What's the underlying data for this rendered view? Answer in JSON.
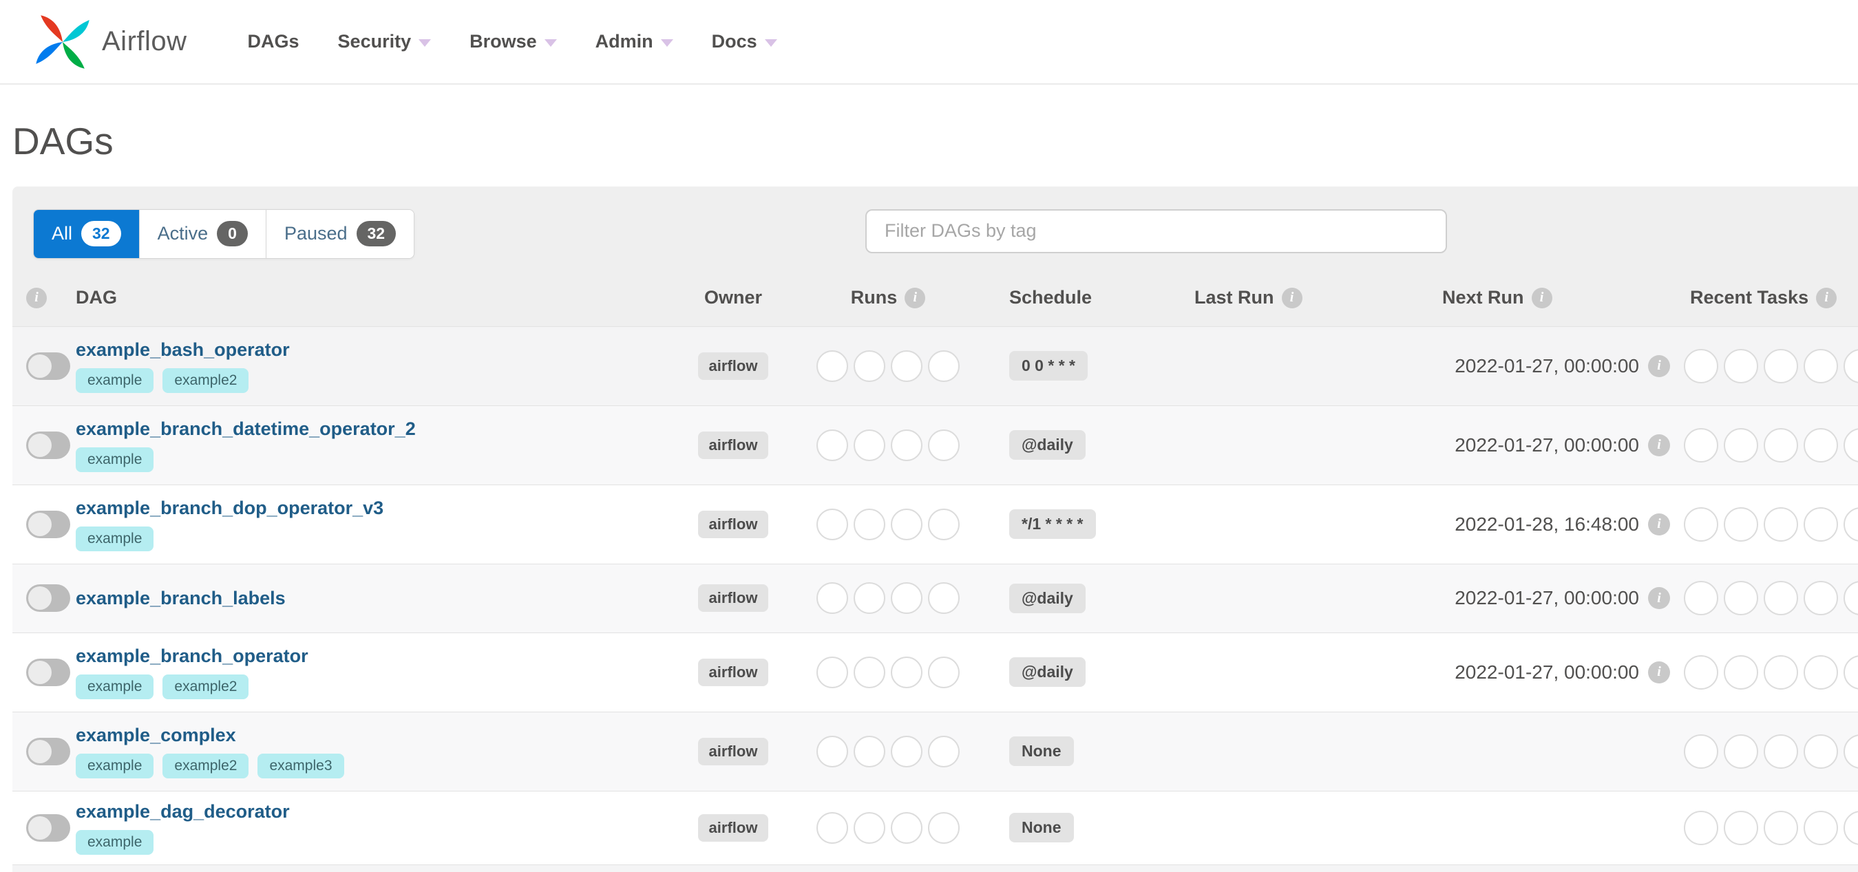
{
  "nav": {
    "brand": "Airflow",
    "items": [
      {
        "label": "DAGs",
        "caret": false
      },
      {
        "label": "Security",
        "caret": true
      },
      {
        "label": "Browse",
        "caret": true
      },
      {
        "label": "Admin",
        "caret": true
      },
      {
        "label": "Docs",
        "caret": true
      }
    ]
  },
  "page": {
    "title": "DAGs"
  },
  "tabs": {
    "all": {
      "label": "All",
      "count": "32"
    },
    "active": {
      "label": "Active",
      "count": "0"
    },
    "paused": {
      "label": "Paused",
      "count": "32"
    }
  },
  "filter": {
    "placeholder": "Filter DAGs by tag"
  },
  "table": {
    "headers": {
      "dag": "DAG",
      "owner": "Owner",
      "runs": "Runs",
      "schedule": "Schedule",
      "last_run": "Last Run",
      "next_run": "Next Run",
      "recent_tasks": "Recent Tasks"
    },
    "rows": [
      {
        "name": "example_bash_operator",
        "tags": [
          "example",
          "example2"
        ],
        "owner": "airflow",
        "schedule": "0 0 * * *",
        "last_run": "",
        "next_run": "2022-01-27, 00:00:00"
      },
      {
        "name": "example_branch_datetime_operator_2",
        "tags": [
          "example"
        ],
        "owner": "airflow",
        "schedule": "@daily",
        "last_run": "",
        "next_run": "2022-01-27, 00:00:00"
      },
      {
        "name": "example_branch_dop_operator_v3",
        "tags": [
          "example"
        ],
        "owner": "airflow",
        "schedule": "*/1 * * * *",
        "last_run": "",
        "next_run": "2022-01-28, 16:48:00"
      },
      {
        "name": "example_branch_labels",
        "tags": [],
        "owner": "airflow",
        "schedule": "@daily",
        "last_run": "",
        "next_run": "2022-01-27, 00:00:00"
      },
      {
        "name": "example_branch_operator",
        "tags": [
          "example",
          "example2"
        ],
        "owner": "airflow",
        "schedule": "@daily",
        "last_run": "",
        "next_run": "2022-01-27, 00:00:00"
      },
      {
        "name": "example_complex",
        "tags": [
          "example",
          "example2",
          "example3"
        ],
        "owner": "airflow",
        "schedule": "None",
        "last_run": "",
        "next_run": ""
      },
      {
        "name": "example_dag_decorator",
        "tags": [
          "example"
        ],
        "owner": "airflow",
        "schedule": "None",
        "last_run": "",
        "next_run": ""
      }
    ]
  },
  "colors": {
    "active_tab": "#0c79d2",
    "logo_red": "#e43921",
    "logo_teal": "#00c7d4",
    "logo_blue": "#017cee",
    "logo_green": "#00ad46"
  }
}
